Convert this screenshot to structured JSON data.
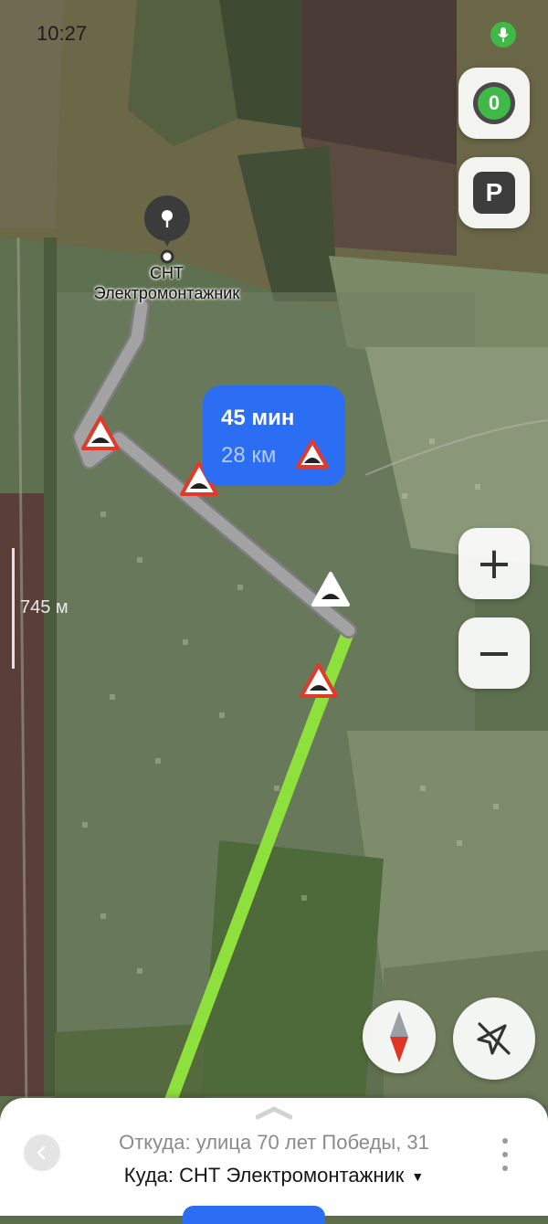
{
  "status_bar": {
    "time": "10:27"
  },
  "route_bubble": {
    "duration": "45 мин",
    "distance": "28 км"
  },
  "destination_label": [
    "СНТ",
    "Электромонтажник"
  ],
  "scale": {
    "label": "745 м"
  },
  "score_badge": "0",
  "parking_label": "P",
  "zoom": {
    "in": "+",
    "out": "−"
  },
  "bottom_sheet": {
    "from": "Откуда: улица 70 лет Победы, 31",
    "to": "Куда: СНТ Электромонтажник",
    "to_arrow": "▼"
  },
  "colors": {
    "accent": "#2b6ef3",
    "route_main": "#8ee03d",
    "route_alt": "#9e9e9e",
    "mic": "#3fba49"
  },
  "icons": [
    "mic-icon",
    "score-icon",
    "parking-icon",
    "zoom-in-icon",
    "zoom-out-icon",
    "compass-icon",
    "follow-off-icon",
    "back-icon",
    "more-icon",
    "speed-bump-icon",
    "pin-icon",
    "chevron-up-icon"
  ]
}
